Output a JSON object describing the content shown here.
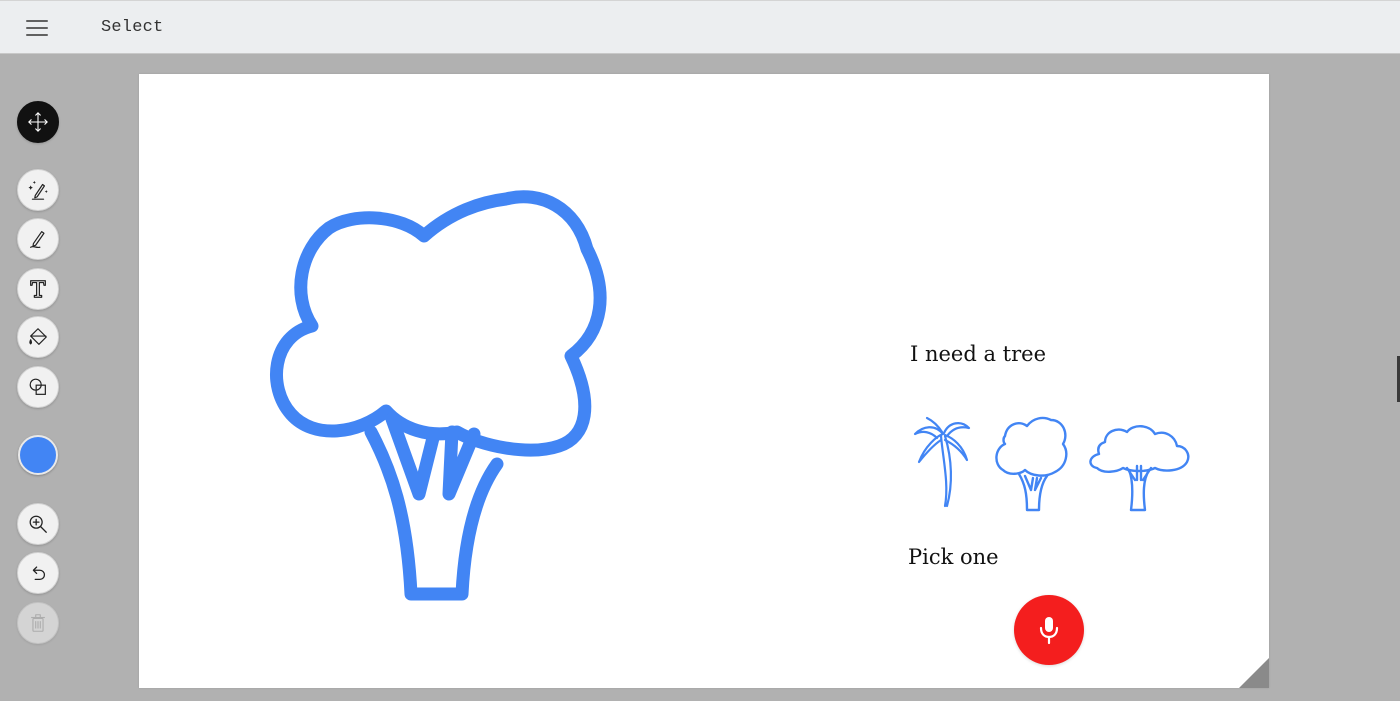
{
  "header": {
    "mode_label": "Select",
    "menu_icon": "hamburger-menu-icon"
  },
  "toolbar": {
    "tools": [
      {
        "name": "move",
        "icon": "move-arrows-icon",
        "active": true
      },
      {
        "name": "autodraw",
        "icon": "magic-pencil-icon",
        "active": false
      },
      {
        "name": "draw",
        "icon": "pencil-icon",
        "active": false
      },
      {
        "name": "type",
        "icon": "text-t-icon",
        "active": false
      },
      {
        "name": "fill",
        "icon": "paint-bucket-icon",
        "active": false
      },
      {
        "name": "shape",
        "icon": "shapes-icon",
        "active": false
      },
      {
        "name": "zoom",
        "icon": "zoom-in-icon",
        "active": false
      },
      {
        "name": "undo",
        "icon": "undo-icon",
        "active": false
      },
      {
        "name": "delete",
        "icon": "trash-icon",
        "active": false,
        "disabled": true
      }
    ],
    "current_color": "#4285f4"
  },
  "canvas": {
    "stroke_color": "#4285f4",
    "prompt": "I need a tree",
    "suggestions_label": "Pick one",
    "suggestions": [
      {
        "name": "palm-tree",
        "icon": "palm-tree-icon"
      },
      {
        "name": "broccoli-tree",
        "icon": "round-tree-icon"
      },
      {
        "name": "acacia-tree",
        "icon": "wide-tree-icon"
      }
    ],
    "mic_color": "#f41e1e",
    "mic_icon": "microphone-icon"
  }
}
